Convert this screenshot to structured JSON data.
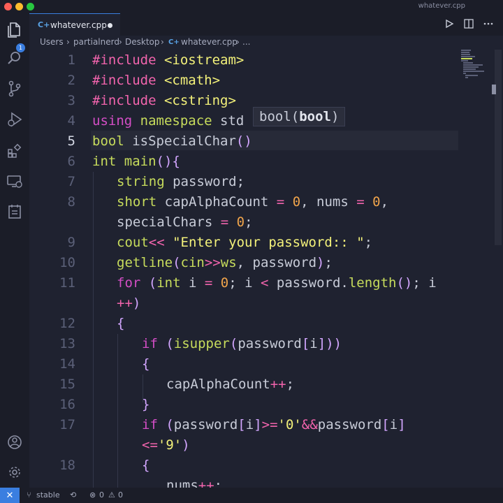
{
  "window": {
    "title": "whatever.cpp"
  },
  "activity_bar": {
    "icons": [
      "explorer-icon",
      "search-icon",
      "source-control-icon",
      "run-debug-icon",
      "extensions-icon",
      "remote-explorer-icon",
      "testing-icon",
      "account-icon",
      "settings-icon"
    ],
    "explorer_badge": "1"
  },
  "tab": {
    "label": "whatever.cpp",
    "icon": "C+"
  },
  "breadcrumb": {
    "items": [
      "Users",
      "partialnerd",
      "Desktop",
      "whatever.cpp",
      "..."
    ],
    "separator": "›"
  },
  "tooltip": {
    "pre": "bool(",
    "bold": "bool",
    "post": ")"
  },
  "editor": {
    "line_numbers": [
      "1",
      "2",
      "3",
      "4",
      "5",
      "6",
      "7",
      "8",
      "",
      "9",
      "10",
      "11",
      "",
      "12",
      "13",
      "14",
      "15",
      "16",
      "17",
      "",
      "18",
      ""
    ],
    "active_line": "5"
  },
  "status": {
    "branch": "stable",
    "errors": "0",
    "warnings": "0"
  },
  "colors": {
    "accent": "#3a7ee0",
    "background": "#1f2230",
    "keyword": "#d44ec6",
    "type": "#c7dc5c",
    "string": "#f3f17a",
    "number": "#f0a44b"
  }
}
